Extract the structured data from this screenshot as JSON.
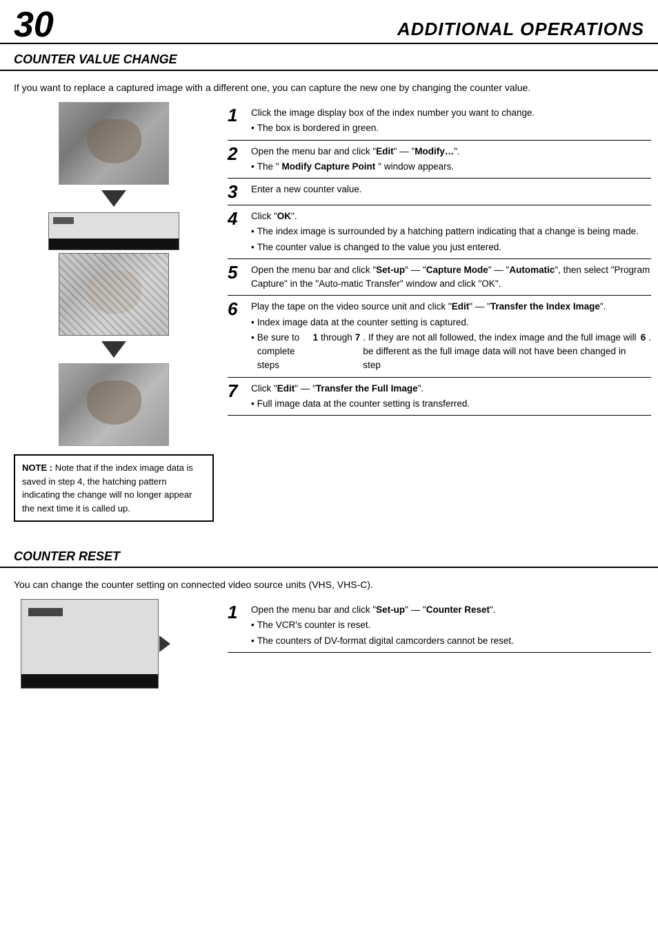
{
  "header": {
    "page_number": "30",
    "title": "ADDITIONAL OPERATIONS"
  },
  "section1": {
    "title": "COUNTER VALUE CHANGE",
    "description": "If you want to replace a captured image with a different one, you can capture the new one by changing the counter value.",
    "steps": [
      {
        "number": "1",
        "text": "Click the image display box of the index number you want to change.",
        "bullets": [
          "The box is bordered in green."
        ]
      },
      {
        "number": "2",
        "text": "Open the menu bar and click \"Edit\" — \"Modify…\".",
        "bullets": [
          "The \"Modify Capture Point\" window appears."
        ]
      },
      {
        "number": "3",
        "text": "Enter a new counter value.",
        "bullets": []
      },
      {
        "number": "4",
        "text": "Click \"OK\".",
        "bullets": [
          "The index image is surrounded by a hatching pattern indicating that a change is being made.",
          "The counter value is changed to the value you just entered."
        ]
      },
      {
        "number": "5",
        "text": "Open the menu bar and click \"Set-up\" — \"Capture Mode\" — \"Automatic\", then select \"Program Capture\" in the \"Auto-matic Transfer\" window and click \"OK\".",
        "bullets": []
      },
      {
        "number": "6",
        "text": "Play the tape on the video source unit and click \"Edit\" — \"Transfer the Index Image\".",
        "bullets": [
          "Index image data at the counter setting is captured.",
          "Be sure to complete steps 1 through 7. If they are not all followed, the index image and the full image will be different as the full image data will not have been changed in step 6."
        ]
      },
      {
        "number": "7",
        "text": "Click \"Edit\" — \"Transfer the Full Image\".",
        "bullets": [
          "Full image data at the counter setting is transferred."
        ]
      }
    ],
    "note": {
      "label": "NOTE :",
      "text": "Note that if the index image data is saved in step 4, the hatching pattern indicating the change will no longer appear the next time it is called up."
    }
  },
  "section2": {
    "title": "COUNTER RESET",
    "description": "You can change the counter setting on connected video source units (VHS, VHS-C).",
    "steps": [
      {
        "number": "1",
        "text": "Open the menu bar and click \"Set-up\" — \"Counter Reset\".",
        "bullets": [
          "The VCR's counter is reset.",
          "The counters of DV-format digital camcorders cannot be reset."
        ]
      }
    ]
  }
}
